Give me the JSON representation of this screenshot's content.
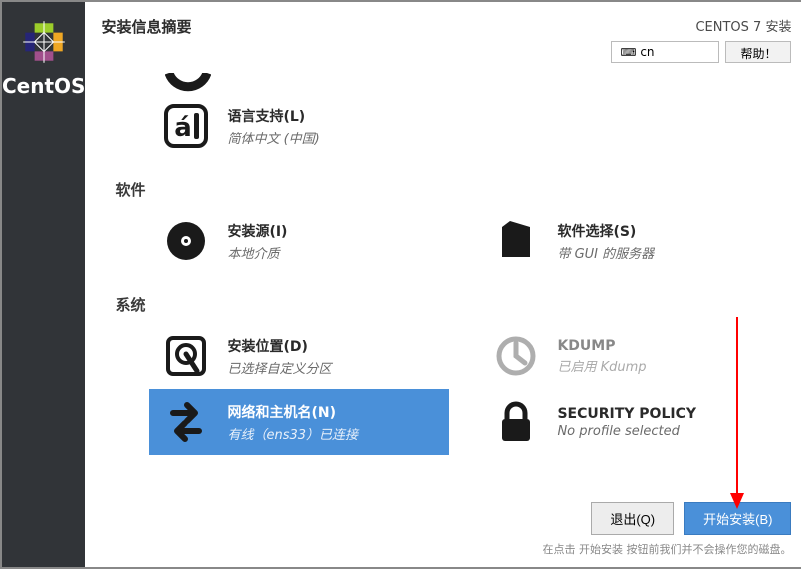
{
  "brand": "CentOS",
  "header": {
    "title": "安装信息摘要",
    "installer": "CENTOS 7 安装",
    "lang_code": "cn",
    "help_label": "帮助！"
  },
  "categories": {
    "software": "软件",
    "system": "系统"
  },
  "spokes": {
    "language": {
      "title": "语言支持(L)",
      "subtitle": "简体中文 (中国)"
    },
    "source": {
      "title": "安装源(I)",
      "subtitle": "本地介质"
    },
    "software_selection": {
      "title": "软件选择(S)",
      "subtitle": "带 GUI 的服务器"
    },
    "destination": {
      "title": "安装位置(D)",
      "subtitle": "已选择自定义分区"
    },
    "kdump": {
      "title": "KDUMP",
      "subtitle": "已启用 Kdump"
    },
    "network": {
      "title": "网络和主机名(N)",
      "subtitle": "有线（ens33）已连接"
    },
    "security": {
      "title": "SECURITY POLICY",
      "subtitle": "No profile selected"
    }
  },
  "footer": {
    "quit": "退出(Q)",
    "begin": "开始安装(B)",
    "hint": "在点击 开始安装 按钮前我们并不会操作您的磁盘。"
  }
}
